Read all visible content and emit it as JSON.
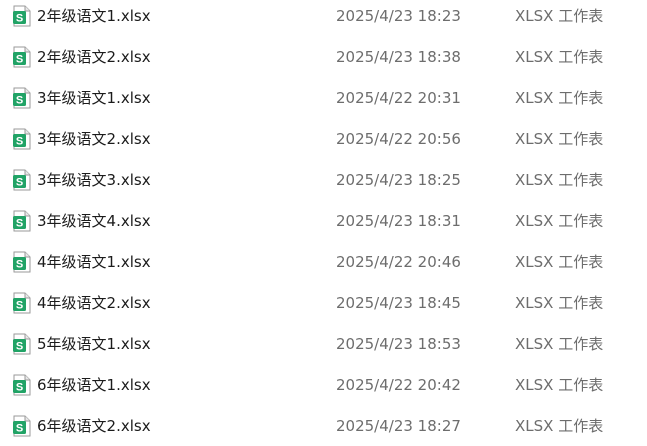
{
  "icon": {
    "name": "xlsx-spreadsheet-icon",
    "glyph": "S",
    "color": "#21a366"
  },
  "files": [
    {
      "name": "2年级语文1.xlsx",
      "modified": "2025/4/23 18:23",
      "type": "XLSX 工作表"
    },
    {
      "name": "2年级语文2.xlsx",
      "modified": "2025/4/23 18:38",
      "type": "XLSX 工作表"
    },
    {
      "name": "3年级语文1.xlsx",
      "modified": "2025/4/22 20:31",
      "type": "XLSX 工作表"
    },
    {
      "name": "3年级语文2.xlsx",
      "modified": "2025/4/22 20:56",
      "type": "XLSX 工作表"
    },
    {
      "name": "3年级语文3.xlsx",
      "modified": "2025/4/23 18:25",
      "type": "XLSX 工作表"
    },
    {
      "name": "3年级语文4.xlsx",
      "modified": "2025/4/23 18:31",
      "type": "XLSX 工作表"
    },
    {
      "name": "4年级语文1.xlsx",
      "modified": "2025/4/22 20:46",
      "type": "XLSX 工作表"
    },
    {
      "name": "4年级语文2.xlsx",
      "modified": "2025/4/23 18:45",
      "type": "XLSX 工作表"
    },
    {
      "name": "5年级语文1.xlsx",
      "modified": "2025/4/23 18:53",
      "type": "XLSX 工作表"
    },
    {
      "name": "6年级语文1.xlsx",
      "modified": "2025/4/22 20:42",
      "type": "XLSX 工作表"
    },
    {
      "name": "6年级语文2.xlsx",
      "modified": "2025/4/23 18:27",
      "type": "XLSX 工作表"
    }
  ]
}
